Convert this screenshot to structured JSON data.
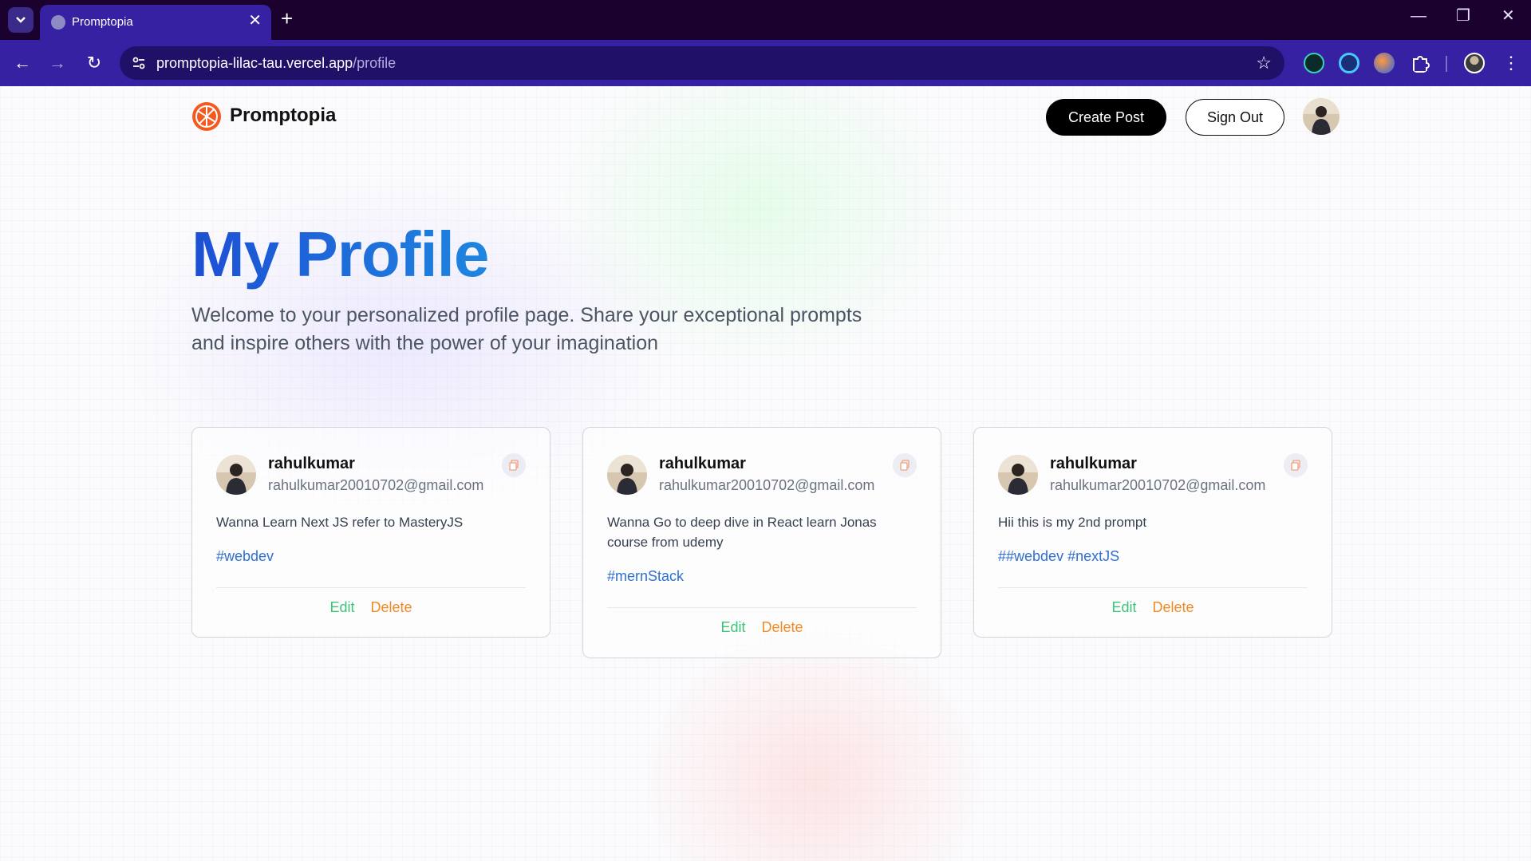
{
  "browser": {
    "tab_title": "Promptopia",
    "url_host": "promptopia-lilac-tau.vercel.app",
    "url_path": "/profile",
    "new_tab_label": "+",
    "tab_close_label": "✕"
  },
  "nav": {
    "brand": "Promptopia",
    "create_post": "Create Post",
    "sign_out": "Sign Out"
  },
  "profile": {
    "title": "My Profile",
    "description": "Welcome to your personalized profile page. Share your exceptional prompts and inspire others with the power of your imagination"
  },
  "cards": [
    {
      "username": "rahulkumar",
      "email": "rahulkumar20010702@gmail.com",
      "prompt": "Wanna Learn Next JS refer to MasteryJS",
      "tags": "#webdev",
      "edit": "Edit",
      "delete": "Delete"
    },
    {
      "username": "rahulkumar",
      "email": "rahulkumar20010702@gmail.com",
      "prompt": "Wanna Go to deep dive in React learn Jonas course from udemy",
      "tags": "#mernStack",
      "edit": "Edit",
      "delete": "Delete"
    },
    {
      "username": "rahulkumar",
      "email": "rahulkumar20010702@gmail.com",
      "prompt": "Hii this is my 2nd prompt",
      "tags": "##webdev #nextJS",
      "edit": "Edit",
      "delete": "Delete"
    }
  ],
  "colors": {
    "title_blue": "#1d5fd6",
    "edit_green": "#3cc47a",
    "delete_orange": "#f08a24",
    "tag_blue": "#2f6fd0",
    "browser_purple": "#3621a3"
  },
  "icons": [
    "tab-search-icon",
    "globe-icon",
    "close-icon",
    "back-icon",
    "forward-icon",
    "reload-icon",
    "site-settings-icon",
    "star-icon",
    "extension-icon",
    "menu-icon",
    "copy-icon",
    "logo-icon"
  ]
}
